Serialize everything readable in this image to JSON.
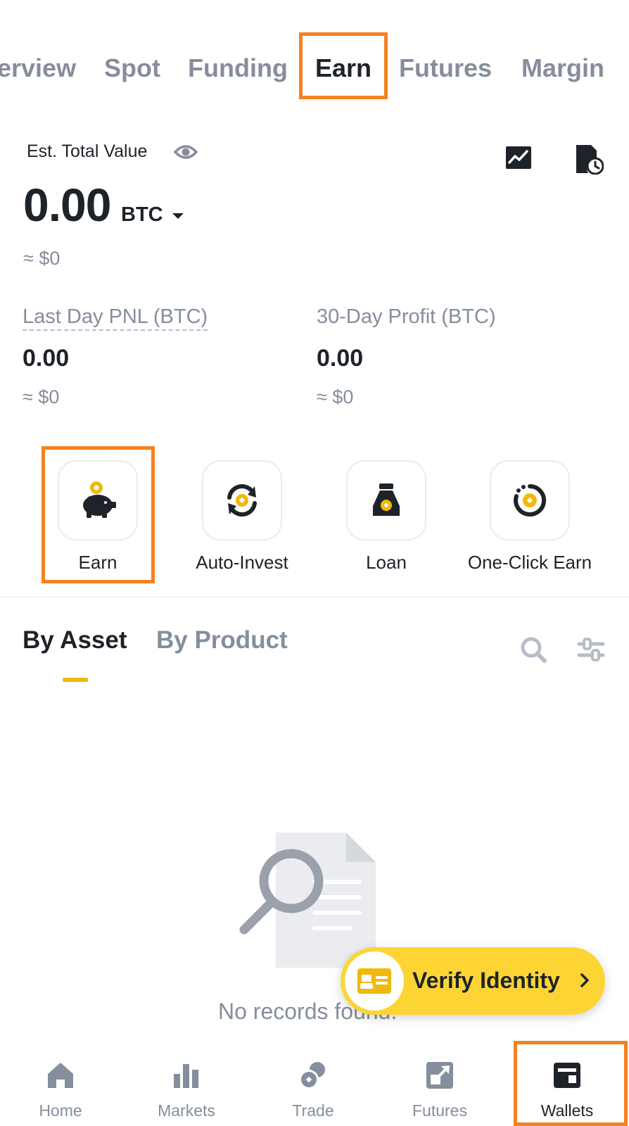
{
  "top_tabs": [
    "erview",
    "Spot",
    "Funding",
    "Earn",
    "Futures",
    "Margin"
  ],
  "active_top_tab": "Earn",
  "summary": {
    "est_label": "Est. Total Value",
    "total_value": "0.00",
    "total_unit": "BTC",
    "total_usd": "≈ $0",
    "last_day_pnl_label": "Last Day PNL (BTC)",
    "last_day_pnl_value": "0.00",
    "last_day_pnl_usd": "≈ $0",
    "profit_30d_label": "30-Day Profit (BTC)",
    "profit_30d_value": "0.00",
    "profit_30d_usd": "≈ $0"
  },
  "actions": [
    {
      "label": "Earn",
      "icon": "piggy-bank-icon"
    },
    {
      "label": "Auto-Invest",
      "icon": "auto-invest-icon"
    },
    {
      "label": "Loan",
      "icon": "loan-bag-icon"
    },
    {
      "label": "One-Click Earn",
      "icon": "one-click-earn-icon"
    }
  ],
  "sub_tabs": [
    "By Asset",
    "By Product"
  ],
  "active_sub_tab": "By Asset",
  "empty_state": "No records found.",
  "verify_button": "Verify Identity",
  "bottom_nav": [
    {
      "label": "Home",
      "icon": "home-icon"
    },
    {
      "label": "Markets",
      "icon": "markets-icon"
    },
    {
      "label": "Trade",
      "icon": "trade-icon"
    },
    {
      "label": "Futures",
      "icon": "futures-icon"
    },
    {
      "label": "Wallets",
      "icon": "wallet-icon"
    }
  ],
  "active_nav": "Wallets",
  "colors": {
    "accent_yellow": "#f0b90b",
    "verify_yellow": "#fcd535",
    "highlight_orange": "#f58220",
    "text_primary": "#1e2329",
    "text_secondary": "#848e9c"
  }
}
